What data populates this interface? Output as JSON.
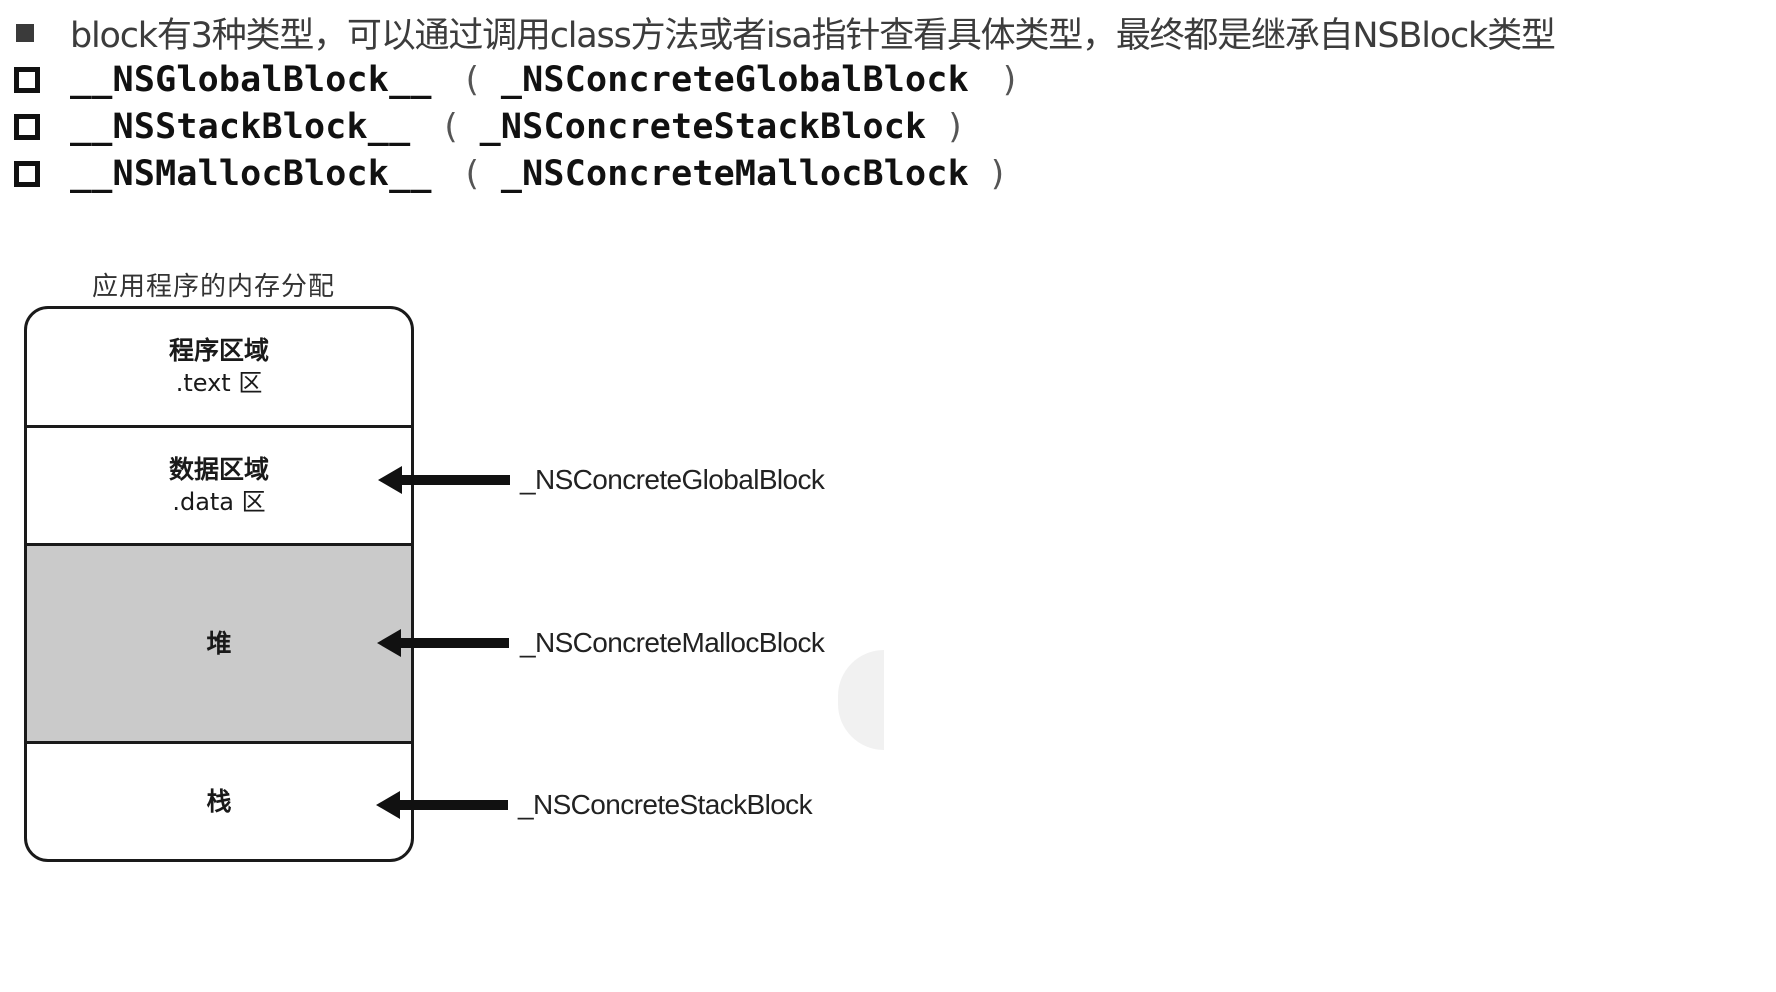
{
  "bullets": {
    "intro": "block有3种类型，可以通过调用class方法或者isa指针查看具体类型，最终都是继承自NSBlock类型",
    "items": [
      {
        "name": "__NSGlobalBlock__",
        "open": "(",
        "concrete": "_NSConcreteGlobalBlock",
        "close": ")"
      },
      {
        "name": "__NSStackBlock__",
        "open": "(",
        "concrete": "_NSConcreteStackBlock",
        "close": ")"
      },
      {
        "name": "__NSMallocBlock__",
        "open": "(",
        "concrete": "_NSConcreteMallocBlock",
        "close": ")"
      }
    ]
  },
  "diagram": {
    "caption": "应用程序的内存分配",
    "segments": [
      {
        "name": "程序区域",
        "sub": ".text 区",
        "fill": "#ffffff"
      },
      {
        "name": "数据区域",
        "sub": ".data 区",
        "fill": "#ffffff"
      },
      {
        "name": "堆",
        "fill": "#cacaca"
      },
      {
        "name": "栈",
        "fill": "#ffffff"
      }
    ],
    "pointers": [
      {
        "label": "_NSConcreteGlobalBlock",
        "target": "数据区域"
      },
      {
        "label": "_NSConcreteMallocBlock",
        "target": "堆"
      },
      {
        "label": "_NSConcreteStackBlock",
        "target": "栈"
      }
    ]
  },
  "icons": {
    "intro_bullet": "square-filled-bullet-icon",
    "item_bullet": "square-outline-bullet-icon",
    "pointer": "left-arrow-icon"
  },
  "colors": {
    "heap_fill": "#cacaca",
    "outline": "#1a1a1a",
    "intro_text": "#3c3c3c"
  }
}
